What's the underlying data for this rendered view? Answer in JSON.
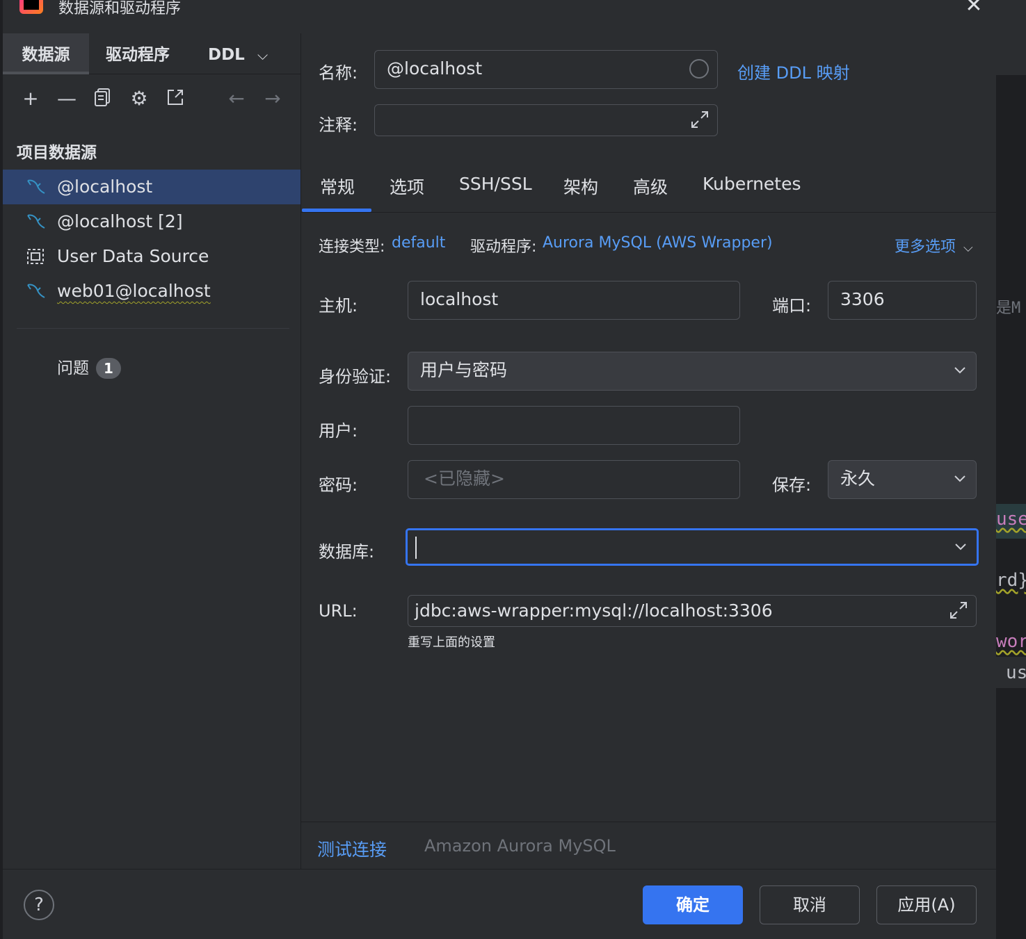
{
  "window": {
    "title": "数据源和驱动程序"
  },
  "left_tabs": [
    "数据源",
    "驱动程序",
    "DDL"
  ],
  "left_toolbar": {
    "icons": [
      "add-icon",
      "remove-icon",
      "duplicate-icon",
      "settings-icon",
      "open-external-icon",
      "back-arrow-icon",
      "forward-arrow-icon"
    ]
  },
  "project_section": "项目数据源",
  "datasources": [
    {
      "label": "@localhost",
      "icon": "mysql-dolphin-icon",
      "selected": true
    },
    {
      "label": "@localhost [2]",
      "icon": "mysql-dolphin-icon",
      "selected": false
    },
    {
      "label": "User Data Source",
      "icon": "user-datasource-icon",
      "selected": false
    },
    {
      "label": "web01@localhost",
      "icon": "mysql-dolphin-icon",
      "selected": false
    }
  ],
  "problems": {
    "label": "问题",
    "count": "1"
  },
  "form": {
    "name_label": "名称:",
    "name_value": "@localhost",
    "create_ddl_link": "创建 DDL 映射",
    "comment_label": "注释:",
    "comment_value": ""
  },
  "tabs": [
    "常规",
    "选项",
    "SSH/SSL",
    "架构",
    "高级",
    "Kubernetes"
  ],
  "active_tab": "常规",
  "connection": {
    "type_label": "连接类型:",
    "type_value": "default",
    "driver_label": "驱动程序:",
    "driver_value": "Aurora MySQL (AWS Wrapper)",
    "more_options": "更多选项"
  },
  "general": {
    "host_label": "主机:",
    "host_value": "localhost",
    "port_label": "端口:",
    "port_value": "3306",
    "auth_label": "身份验证:",
    "auth_value": "用户与密码",
    "user_label": "用户:",
    "user_value": "",
    "password_label": "密码:",
    "password_placeholder": "<已隐藏>",
    "save_label": "保存:",
    "save_value": "永久",
    "database_label": "数据库:",
    "database_value": "",
    "url_label": "URL:",
    "url_value": "jdbc:aws-wrapper:mysql://localhost:3306",
    "url_hint": "重写上面的设置"
  },
  "bottom_bar": {
    "test_connection": "测试连接",
    "dbms_name": "Amazon Aurora MySQL"
  },
  "footer": {
    "ok": "确定",
    "cancel": "取消",
    "apply": "应用(A)"
  },
  "background_code": [
    "是M",
    "use",
    "rd}",
    "wor",
    "us"
  ],
  "colors": {
    "accent": "#3574f0",
    "link": "#589df6",
    "selection": "#2e436e",
    "background": "#2b2d30"
  }
}
